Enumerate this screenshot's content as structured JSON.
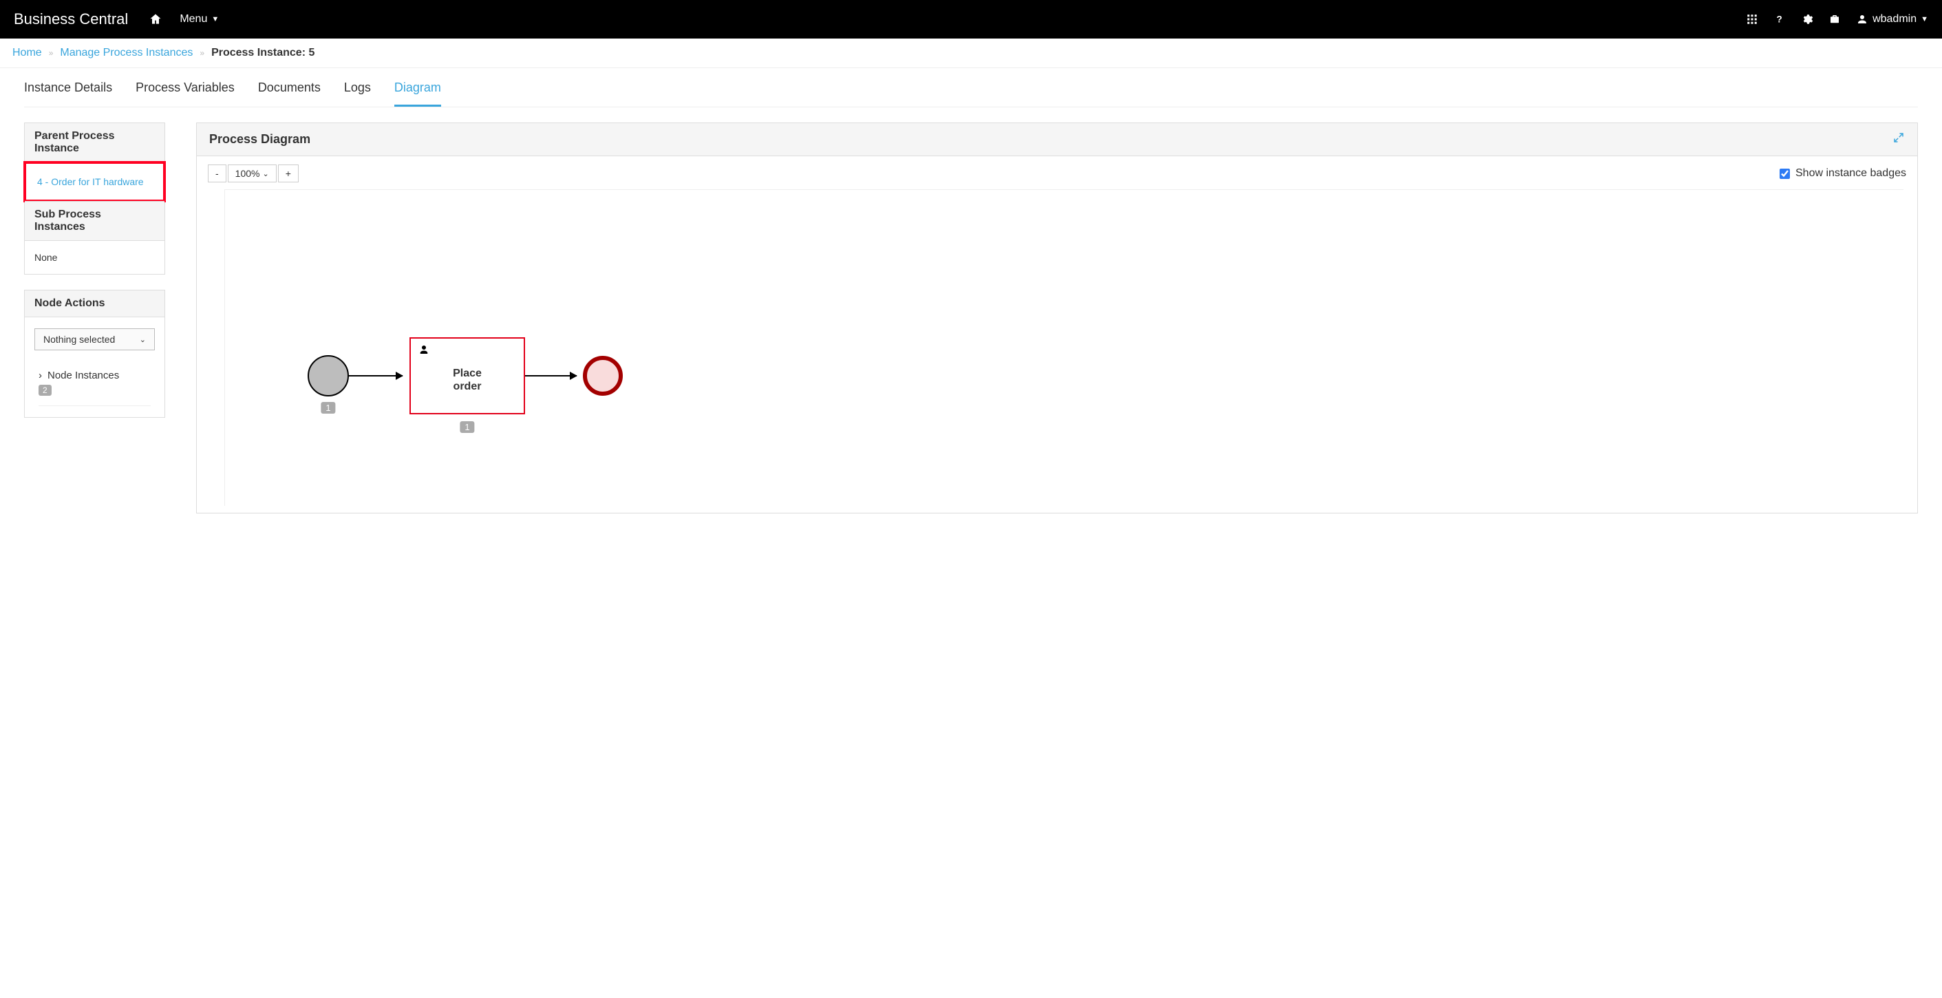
{
  "header": {
    "brand": "Business Central",
    "menu_label": "Menu",
    "user_label": "wbadmin"
  },
  "breadcrumbs": {
    "home": "Home",
    "manage": "Manage Process Instances",
    "current": "Process Instance: 5"
  },
  "tabs": {
    "instance_details": "Instance Details",
    "process_variables": "Process Variables",
    "documents": "Documents",
    "logs": "Logs",
    "diagram": "Diagram"
  },
  "side": {
    "parent_title": "Parent Process Instance",
    "parent_link": "4 - Order for IT hardware",
    "sub_title": "Sub Process Instances",
    "sub_none": "None",
    "node_actions_title": "Node Actions",
    "node_actions_select": "Nothing selected",
    "node_instances_label": "Node Instances",
    "node_instances_count": "2"
  },
  "diagram": {
    "panel_title": "Process Diagram",
    "zoom_minus": "-",
    "zoom_value": "100%",
    "zoom_plus": "+",
    "show_badges_label": "Show instance badges",
    "task_label_1": "Place",
    "task_label_2": "order",
    "start_badge": "1",
    "task_badge": "1"
  }
}
